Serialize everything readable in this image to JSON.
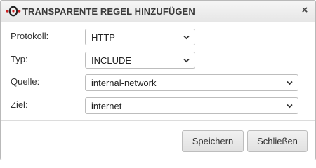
{
  "dialog": {
    "title": "TRANSPARENTE REGEL HINZUFÜGEN",
    "logo_icon": "securepoint-logo-icon",
    "close_icon": "close-x-icon",
    "close_glyph": "×"
  },
  "form": {
    "fields": [
      {
        "label": "Protokoll:",
        "value": "HTTP"
      },
      {
        "label": "Typ:",
        "value": "INCLUDE"
      },
      {
        "label": "Quelle:",
        "value": "internal-network"
      },
      {
        "label": "Ziel:",
        "value": "internet"
      }
    ]
  },
  "buttons": {
    "save_label": "Speichern",
    "close_label": "Schließen"
  },
  "colors": {
    "logo_accent": "#cc2222",
    "titlebar": "#eeeeee",
    "border": "#bdbdbd"
  }
}
